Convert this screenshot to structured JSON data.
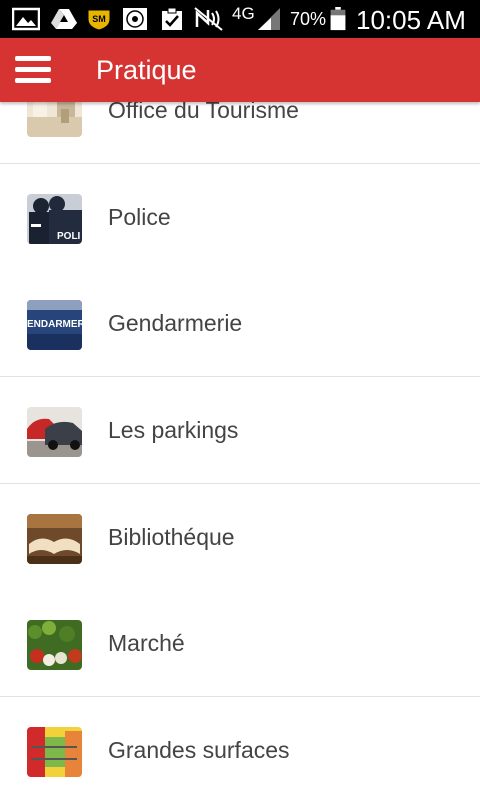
{
  "status_bar": {
    "network": "4G",
    "battery": "70%",
    "time": "10:05 AM",
    "icons": [
      "image-icon",
      "drive-icon",
      "sm-badge-icon",
      "shield-logo-icon",
      "clipboard-check-icon",
      "nfc-muted-icon",
      "signal-icon",
      "battery-icon"
    ],
    "sm_badge": "SM"
  },
  "app_bar": {
    "title": "Pratique",
    "menu_icon": "hamburger-menu-icon",
    "background": "#d63333"
  },
  "list": {
    "items": [
      {
        "label": "Office du Tourisme",
        "icon": "tourism-office-thumbnail"
      },
      {
        "label": "Police",
        "icon": "police-thumbnail",
        "thumb_text": "POLI"
      },
      {
        "label": "Gendarmerie",
        "icon": "gendarmerie-thumbnail",
        "thumb_text": "ENDARMER"
      },
      {
        "label": "Les parkings",
        "icon": "parking-thumbnail"
      },
      {
        "label": "Bibliothéque",
        "icon": "library-thumbnail"
      },
      {
        "label": "Marché",
        "icon": "market-thumbnail"
      },
      {
        "label": "Grandes surfaces",
        "icon": "supermarket-thumbnail"
      }
    ]
  }
}
